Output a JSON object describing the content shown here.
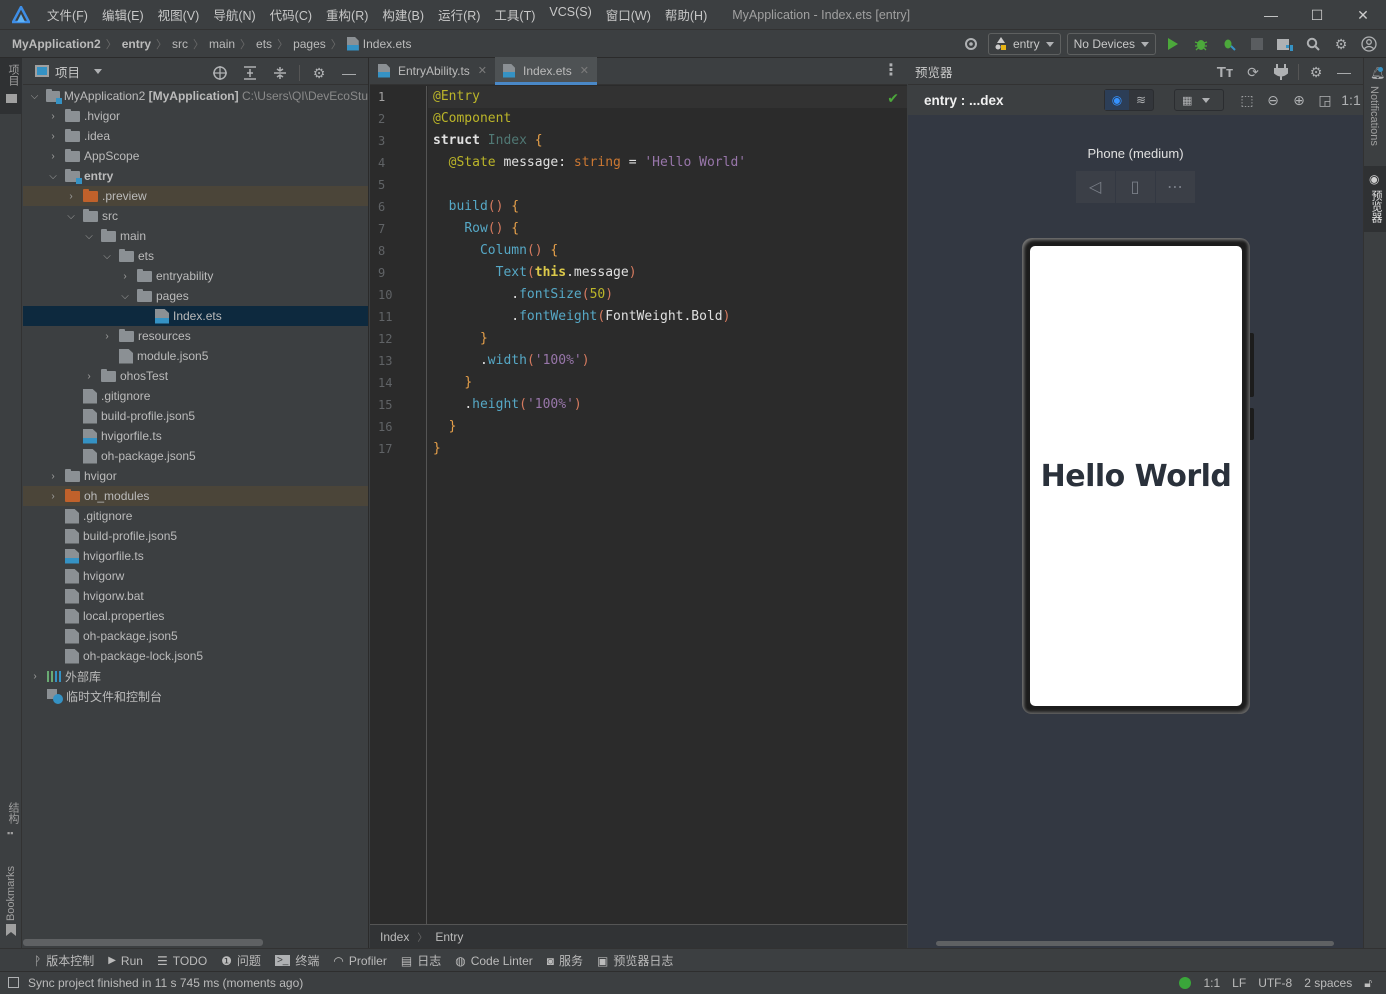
{
  "window": {
    "title": "MyApplication - Index.ets [entry]",
    "menu": [
      "文件(F)",
      "编辑(E)",
      "视图(V)",
      "导航(N)",
      "代码(C)",
      "重构(R)",
      "构建(B)",
      "运行(R)",
      "工具(T)",
      "VCS(S)",
      "窗口(W)",
      "帮助(H)"
    ],
    "controls": {
      "minimize": "—",
      "maximize": "☐",
      "close": "✕"
    }
  },
  "breadcrumb": [
    "MyApplication2",
    "entry",
    "src",
    "main",
    "ets",
    "pages",
    "Index.ets"
  ],
  "toolbar": {
    "module_combo": "entry",
    "device_combo": "No Devices",
    "icons": [
      "target-icon",
      "run-icon",
      "debug-icon",
      "attach-debugger-icon",
      "stop-icon",
      "project-structure-icon",
      "search-icon",
      "settings-icon",
      "account-icon"
    ]
  },
  "left_strip": {
    "top_label": "项目",
    "structure_label": "结构",
    "bookmarks_label": "Bookmarks"
  },
  "right_strip": {
    "notifications_label": "Notifications",
    "previewer_label": "预览器"
  },
  "project_panel": {
    "title": "项目",
    "root": {
      "name": "MyApplication2",
      "module": "[MyApplication]",
      "path": "C:\\Users\\QI\\DevEcoStu"
    },
    "items": [
      {
        "label": ".hvigor",
        "depth": 1,
        "type": "folder",
        "state": "collapsed"
      },
      {
        "label": ".idea",
        "depth": 1,
        "type": "folder",
        "state": "collapsed"
      },
      {
        "label": "AppScope",
        "depth": 1,
        "type": "folder",
        "state": "collapsed"
      },
      {
        "label": "entry",
        "depth": 1,
        "type": "module",
        "state": "expanded"
      },
      {
        "label": ".preview",
        "depth": 2,
        "type": "folder-excluded",
        "state": "collapsed"
      },
      {
        "label": "src",
        "depth": 2,
        "type": "folder",
        "state": "expanded"
      },
      {
        "label": "main",
        "depth": 3,
        "type": "folder",
        "state": "expanded"
      },
      {
        "label": "ets",
        "depth": 4,
        "type": "folder",
        "state": "expanded"
      },
      {
        "label": "entryability",
        "depth": 5,
        "type": "folder",
        "state": "collapsed"
      },
      {
        "label": "pages",
        "depth": 5,
        "type": "folder",
        "state": "expanded"
      },
      {
        "label": "Index.ets",
        "depth": 6,
        "type": "ets",
        "state": "selected"
      },
      {
        "label": "resources",
        "depth": 4,
        "type": "folder",
        "state": "collapsed"
      },
      {
        "label": "module.json5",
        "depth": 4,
        "type": "json",
        "state": "leaf"
      },
      {
        "label": "ohosTest",
        "depth": 3,
        "type": "folder",
        "state": "collapsed"
      },
      {
        "label": ".gitignore",
        "depth": 2,
        "type": "ignore",
        "state": "leaf"
      },
      {
        "label": "build-profile.json5",
        "depth": 2,
        "type": "json",
        "state": "leaf"
      },
      {
        "label": "hvigorfile.ts",
        "depth": 2,
        "type": "ts",
        "state": "leaf"
      },
      {
        "label": "oh-package.json5",
        "depth": 2,
        "type": "json",
        "state": "leaf"
      },
      {
        "label": "hvigor",
        "depth": 1,
        "type": "folder",
        "state": "collapsed"
      },
      {
        "label": "oh_modules",
        "depth": 1,
        "type": "folder-excluded",
        "state": "collapsed"
      },
      {
        "label": ".gitignore",
        "depth": 1,
        "type": "ignore",
        "state": "leaf"
      },
      {
        "label": "build-profile.json5",
        "depth": 1,
        "type": "json",
        "state": "leaf"
      },
      {
        "label": "hvigorfile.ts",
        "depth": 1,
        "type": "ts",
        "state": "leaf"
      },
      {
        "label": "hvigorw",
        "depth": 1,
        "type": "shell",
        "state": "leaf"
      },
      {
        "label": "hvigorw.bat",
        "depth": 1,
        "type": "text",
        "state": "leaf"
      },
      {
        "label": "local.properties",
        "depth": 1,
        "type": "properties",
        "state": "leaf"
      },
      {
        "label": "oh-package.json5",
        "depth": 1,
        "type": "json",
        "state": "leaf"
      },
      {
        "label": "oh-package-lock.json5",
        "depth": 1,
        "type": "json",
        "state": "leaf"
      }
    ],
    "external_libs": "外部库",
    "scratches": "临时文件和控制台"
  },
  "editor": {
    "tabs": [
      {
        "label": "EntryAbility.ts",
        "type": "ts",
        "active": false
      },
      {
        "label": "Index.ets",
        "type": "ets",
        "active": true
      }
    ],
    "line_numbers": [
      "1",
      "2",
      "3",
      "4",
      "5",
      "6",
      "7",
      "8",
      "9",
      "10",
      "11",
      "12",
      "13",
      "14",
      "15",
      "16",
      "17"
    ],
    "current_line": 1,
    "breadcrumb": [
      "Index",
      "Entry"
    ]
  },
  "preview": {
    "title": "预览器",
    "page_label": "entry : ...dex",
    "zoom_label": "1:1",
    "device_name": "Phone (medium)",
    "screen_text": "Hello World"
  },
  "tool_windows": [
    "版本控制",
    "Run",
    "TODO",
    "问题",
    "终端",
    "Profiler",
    "日志",
    "Code Linter",
    "服务",
    "预览器日志"
  ],
  "status": {
    "message": "Sync project finished in 11 s 745 ms (moments ago)",
    "position": "1:1",
    "line_sep": "LF",
    "encoding": "UTF-8",
    "indent": "2 spaces"
  }
}
